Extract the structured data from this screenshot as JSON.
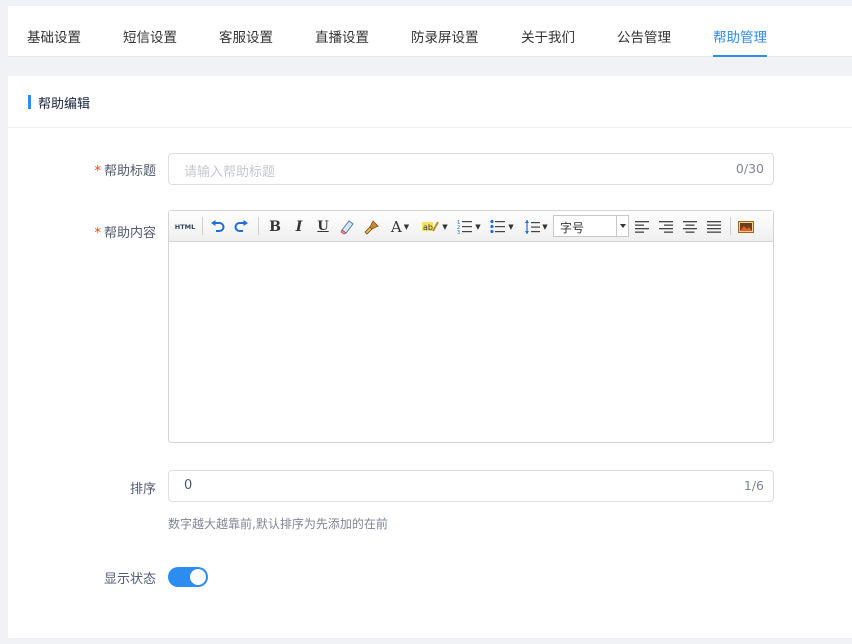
{
  "tabs": [
    {
      "label": "基础设置",
      "active": false
    },
    {
      "label": "短信设置",
      "active": false
    },
    {
      "label": "客服设置",
      "active": false
    },
    {
      "label": "直播设置",
      "active": false
    },
    {
      "label": "防录屏设置",
      "active": false
    },
    {
      "label": "关于我们",
      "active": false
    },
    {
      "label": "公告管理",
      "active": false
    },
    {
      "label": "帮助管理",
      "active": true
    }
  ],
  "card": {
    "title": "帮助编辑"
  },
  "form": {
    "required_mark": "*",
    "title_label": "帮助标题",
    "title_placeholder": "请输入帮助标题",
    "title_count": "0/30",
    "content_label": "帮助内容",
    "sort_label": "排序",
    "sort_value": "0",
    "sort_count": "1/6",
    "sort_hint": "数字越大越靠前,默认排序为先添加的在前",
    "status_label": "显示状态",
    "status_on": true
  },
  "editor": {
    "html_button": "HTML",
    "font_size_value": "字号",
    "toolbar_icons": [
      "html-source-icon",
      "undo-icon",
      "redo-icon",
      "bold-icon",
      "italic-icon",
      "underline-icon",
      "eraser-icon",
      "format-brush-icon",
      "font-color-icon",
      "highlight-color-icon",
      "ordered-list-icon",
      "unordered-list-icon",
      "line-height-icon",
      "align-left-icon",
      "align-right-icon",
      "align-center-icon",
      "justify-icon",
      "image-icon"
    ]
  },
  "colors": {
    "accent": "#2d8cf0",
    "required": "#ed4014"
  }
}
